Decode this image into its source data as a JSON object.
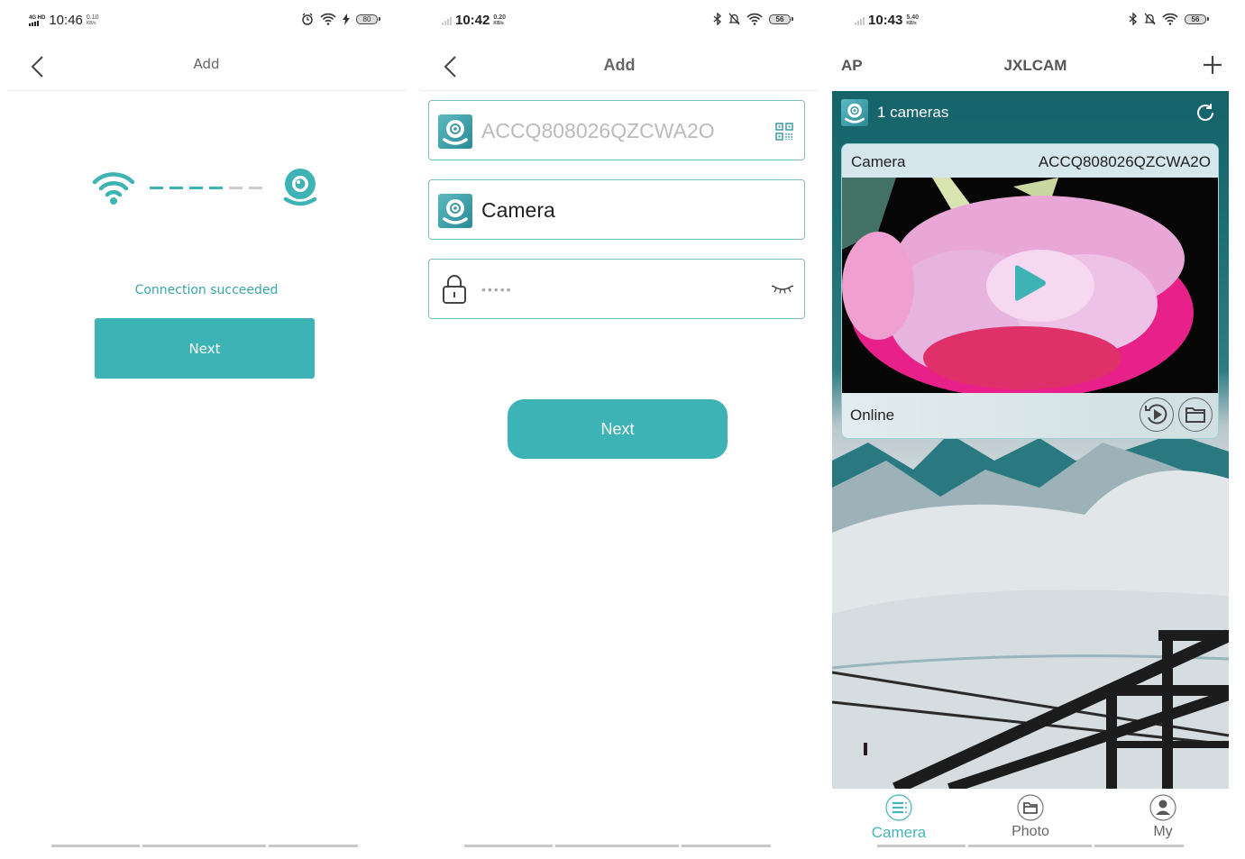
{
  "screens": [
    {
      "status": {
        "network": "4G HD",
        "time": "10:46",
        "speed_value": "0.10",
        "speed_unit": "KB/s",
        "battery": "80",
        "icons": [
          "alarm-icon",
          "wifi-icon",
          "charging-icon",
          "battery-icon"
        ]
      },
      "nav": {
        "back_icon": "chevron-left-icon",
        "title": "Add"
      },
      "connection": {
        "progress_segments_done": 4,
        "progress_segments_total": 6,
        "message": "Connection succeeded"
      },
      "next_label": "Next"
    },
    {
      "status": {
        "time": "10:42",
        "speed_value": "0.20",
        "speed_unit": "KB/s",
        "battery": "56",
        "icons": [
          "bluetooth-icon",
          "bell-muted-icon",
          "wifi-icon",
          "battery-icon"
        ]
      },
      "nav": {
        "back_icon": "chevron-left-icon",
        "title": "Add"
      },
      "form": {
        "device_id": {
          "value": "ACCQ808026QZCWA2O",
          "icon": "camera-app-icon",
          "action_icon": "qr-code-icon"
        },
        "device_name": {
          "value": "Camera",
          "icon": "camera-app-icon"
        },
        "password": {
          "masked_value": "•••••",
          "icon": "lock-icon",
          "toggle_icon": "eye-closed-icon"
        }
      },
      "next_label": "Next"
    },
    {
      "status": {
        "time": "10:43",
        "speed_value": "5.40",
        "speed_unit": "KB/s",
        "battery": "56",
        "icons": [
          "bluetooth-icon",
          "bell-muted-icon",
          "wifi-icon",
          "battery-icon"
        ]
      },
      "nav": {
        "left_label": "AP",
        "title": "JXLCAM",
        "add_icon": "plus-icon"
      },
      "list_header": {
        "count_label": "1 cameras",
        "refresh_icon": "refresh-icon"
      },
      "camera": {
        "name": "Camera",
        "id": "ACCQ808026QZCWA2O",
        "status": "Online",
        "play_icon": "play-icon",
        "playback_icon": "replay-icon",
        "files_icon": "folder-icon"
      },
      "tabs": [
        {
          "label": "Camera",
          "icon": "list-icon",
          "active": true
        },
        {
          "label": "Photo",
          "icon": "folder-icon",
          "active": false
        },
        {
          "label": "My",
          "icon": "user-icon",
          "active": false
        }
      ]
    }
  ],
  "colors": {
    "accent": "#3eb3b5",
    "accent_text": "#3aa6a8",
    "header_dark": "#16636a",
    "field_border": "#7fbcc3"
  }
}
